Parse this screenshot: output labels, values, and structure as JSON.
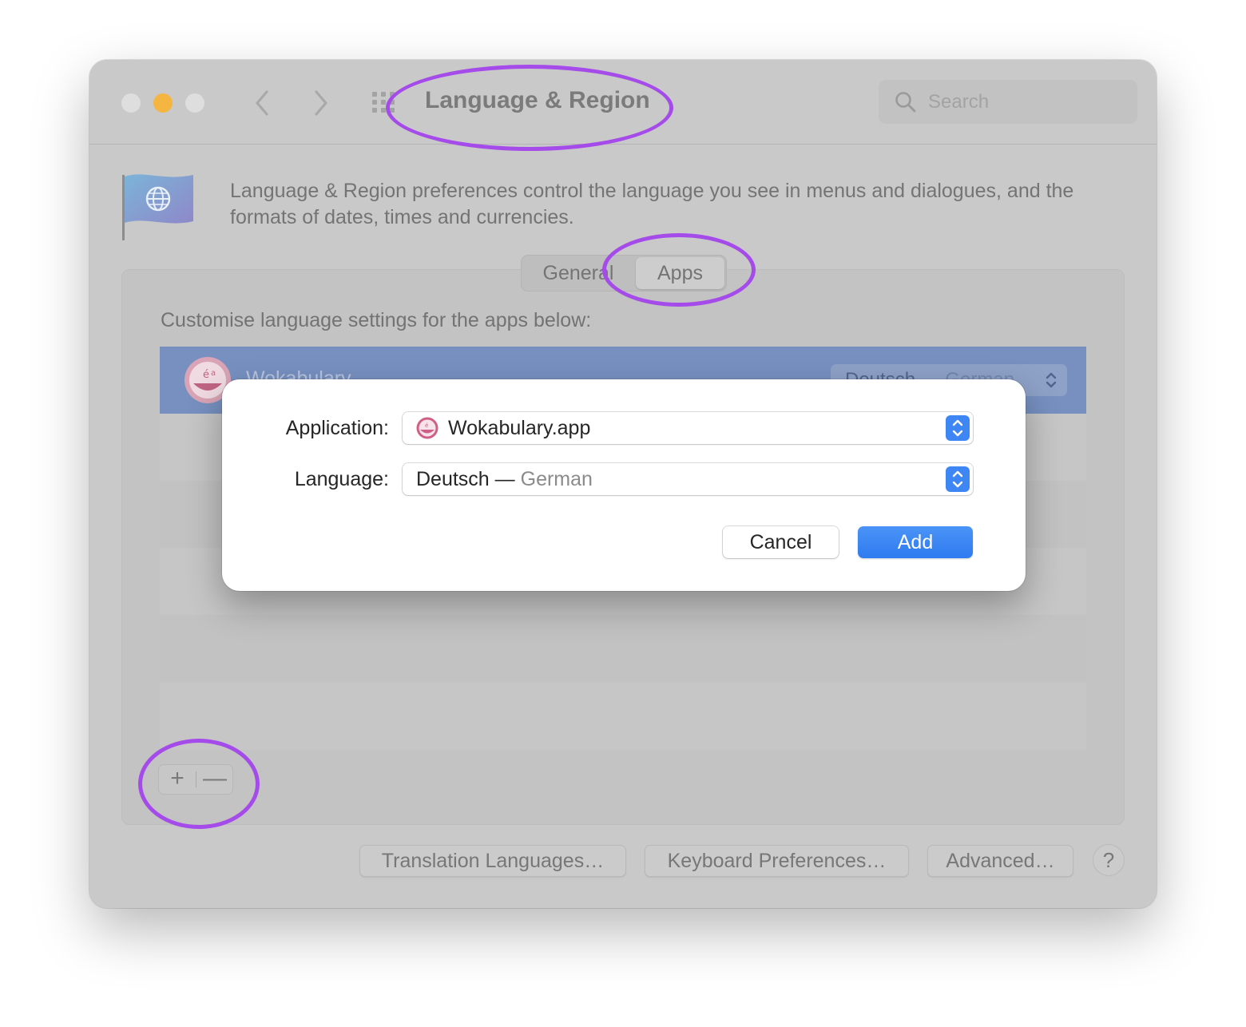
{
  "window": {
    "title": "Language & Region",
    "search_placeholder": "Search"
  },
  "header": {
    "description": "Language & Region preferences control the language you see in menus and dialogues, and the formats of dates, times and currencies."
  },
  "tabs": [
    {
      "label": "General",
      "selected": false
    },
    {
      "label": "Apps",
      "selected": true
    }
  ],
  "apps_panel": {
    "instruction": "Customise language settings for the apps below:",
    "rows": [
      {
        "name": "Wokabulary",
        "language": "Deutsch",
        "language_sub": "German",
        "selected": true
      }
    ],
    "plus_label": "+",
    "minus_label": "—"
  },
  "bottom_buttons": {
    "translation": "Translation Languages…",
    "keyboard": "Keyboard Preferences…",
    "advanced": "Advanced…",
    "help": "?"
  },
  "sheet": {
    "application_label": "Application:",
    "application_value": "Wokabulary.app",
    "language_label": "Language:",
    "language_value": "Deutsch",
    "language_separator": "—",
    "language_sub": "German",
    "cancel_label": "Cancel",
    "add_label": "Add"
  },
  "colors": {
    "accent": "#3f86f5",
    "annotation": "#a54bea",
    "selected_row": "#7790c0",
    "traffic_yellow": "#f4b641"
  }
}
